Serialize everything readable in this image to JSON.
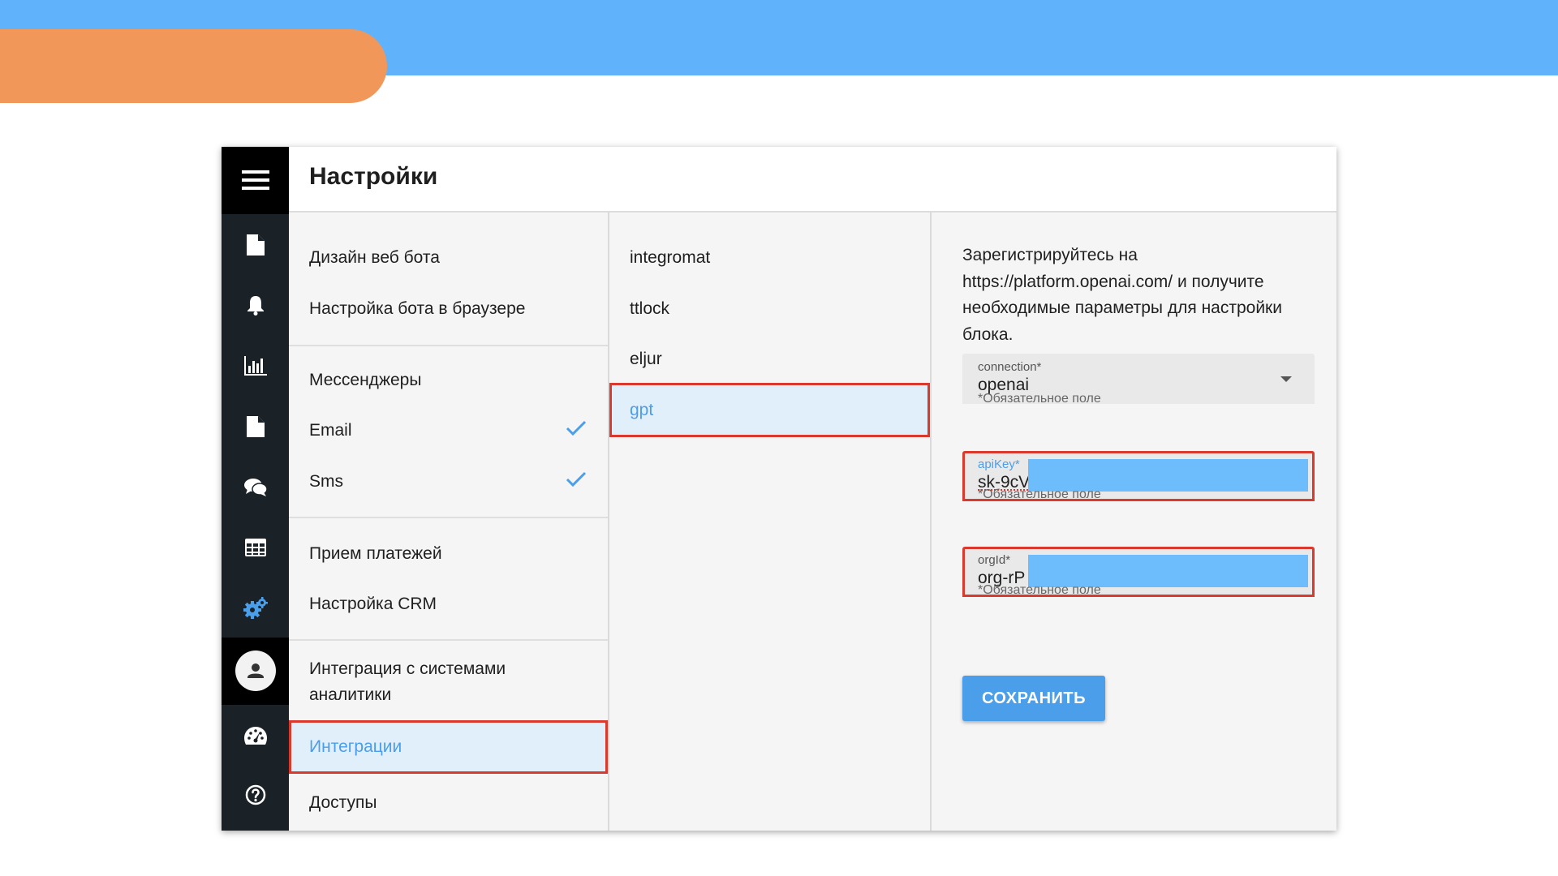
{
  "header": {
    "title": "Настройки"
  },
  "rail": {
    "icons": [
      "menu-icon",
      "document-icon",
      "bell-icon",
      "bar-chart-icon",
      "file-icon",
      "chat-icon",
      "table-icon",
      "gears-icon",
      "user-avatar-icon",
      "speedometer-icon",
      "help-icon"
    ],
    "active_icon": "gears-icon",
    "accent_color": "#4b9ee9"
  },
  "settings_menu": {
    "design_web_bot": "Дизайн веб бота",
    "browser_bot": "Настройка бота в браузере",
    "messengers": "Мессенджеры",
    "email": "Email",
    "sms": "Sms",
    "payments": "Прием платежей",
    "crm": "Настройка CRM",
    "analytics": "Интеграция с системами аналитики",
    "integrations": "Интеграции",
    "access": "Доступы"
  },
  "integrations_list": {
    "items": [
      "integromat",
      "ttlock",
      "eljur",
      "gpt"
    ],
    "selected": "gpt"
  },
  "form": {
    "description": "Зарегистрируйтесь на https://platform.openai.com/ и получите необходимые параметры для настройки блока.",
    "connection": {
      "label": "connection*",
      "value": "openai",
      "hint": "*Обязательное поле"
    },
    "api_key": {
      "label": "apiKey*",
      "value": "sk-9cV",
      "hint": "*Обязательное поле"
    },
    "org_id": {
      "label": "orgId*",
      "value": "org-rP",
      "hint": "*Обязательное поле"
    },
    "save_label": "СОХРАНИТЬ"
  },
  "colors": {
    "highlight_border": "#d93a2d",
    "slide_blue": "#60b2fa",
    "slide_orange": "#f2975a"
  }
}
